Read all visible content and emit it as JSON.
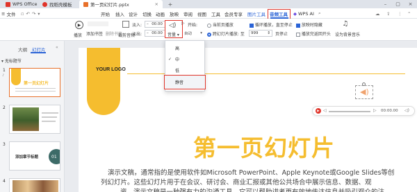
{
  "titlebar": {
    "app_tab": "WPS Office",
    "tabs": [
      {
        "label": "找稻壳模板"
      },
      {
        "label": "第一页幻灯片.pptx"
      }
    ]
  },
  "menubar": {
    "file": "文件",
    "items": [
      "开始",
      "插入",
      "设计",
      "切换",
      "动画",
      "放映",
      "审阅",
      "视图",
      "工具",
      "会员专享"
    ],
    "picture_tools": "图片工具",
    "audio_tools": "音频工具",
    "wps_ai": "WPS AI"
  },
  "ribbon": {
    "play": "播放",
    "add_bookmark": "添加书签",
    "remove_bookmark": "删除书签",
    "crop_audio": "裁剪音频",
    "fade_in_label": "淡入:",
    "fade_out_label": "淡出:",
    "fade_in_value": "00.00",
    "fade_out_value": "00.00",
    "volume": "音量",
    "start_label": "开始:",
    "start_value": "自动",
    "current_page": "当前页播放",
    "cross_slide": "跨幻灯片播放: 至",
    "cross_slide_value": "999",
    "page_stop": "页停止",
    "loop": "循环播放，直至停止",
    "rewind": "播放完返回开头",
    "hide_on_show": "放映时隐藏",
    "bg_music": "设为背景音乐"
  },
  "volume_menu": {
    "items": [
      "高",
      "中",
      "低",
      "静音"
    ],
    "checked": "中"
  },
  "leftpanel": {
    "tab_outline": "大纲",
    "tab_slides": "幻灯片",
    "section": "无标题节",
    "slide_numbers": [
      "1",
      "2",
      "3",
      "4"
    ],
    "thumb1_title": "第一页幻灯片",
    "thumb3_title": "添加章节标题",
    "thumb3_number": "01"
  },
  "slide": {
    "logo": "YOUR LOGO",
    "title": "第一页幻灯片",
    "body_line1": "演示文稿，通常指的是使用软件如Microsoft PowerPoint、Apple Keynote或Google Slides等创",
    "body_line2": "列幻灯片。这些幻灯片用于在会议、研讨会、商业汇报或其他公共场合中展示信息、数据、观",
    "body_line3": "资。演示文稿是一种强有力的沟通工具，它可以帮助讲者更有效地传达信息并吸引观众的注",
    "audio_time": "00:00.00",
    "colors": {
      "accent": "#f5bd2f",
      "title": "#f5bd2f"
    }
  },
  "colors": {
    "brand_blue": "#2a63d6",
    "highlight_red": "#e0342a",
    "wps_red": "#e0342a"
  }
}
